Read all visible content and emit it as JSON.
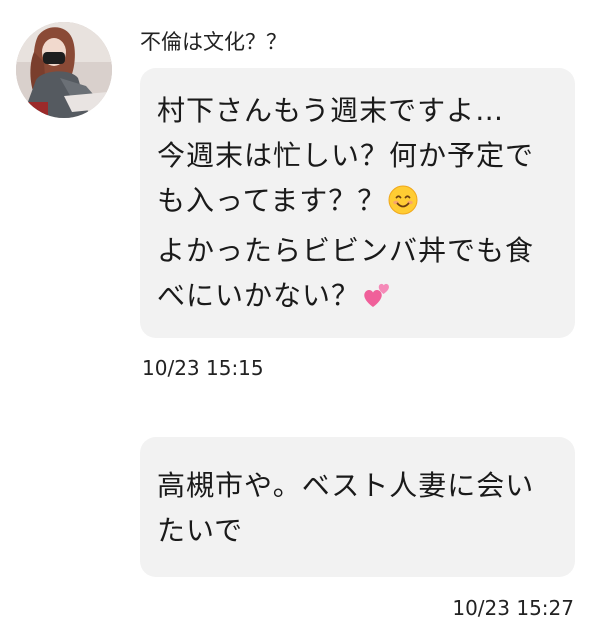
{
  "chat": {
    "sender_name": "不倫は文化？？",
    "messages": [
      {
        "lines": [
          "村下さんもう週末ですよ…",
          "今週末は忙しい？何か予定で",
          "も入ってます？？",
          "よかったらビビンバ丼でも食",
          "べにいかない？"
        ],
        "emoji_after_line_3": "smiling-face-emoji",
        "emoji_after_line_5": "two-hearts-emoji",
        "timestamp": "10/23 15:15"
      },
      {
        "lines": [
          "高槻市や。ベスト人妻に会い",
          "たいで"
        ],
        "timestamp": "10/23 15:27"
      }
    ]
  },
  "colors": {
    "bubble_bg": "#f2f2f2",
    "text": "#1a1a1a",
    "page_bg": "#ffffff"
  }
}
